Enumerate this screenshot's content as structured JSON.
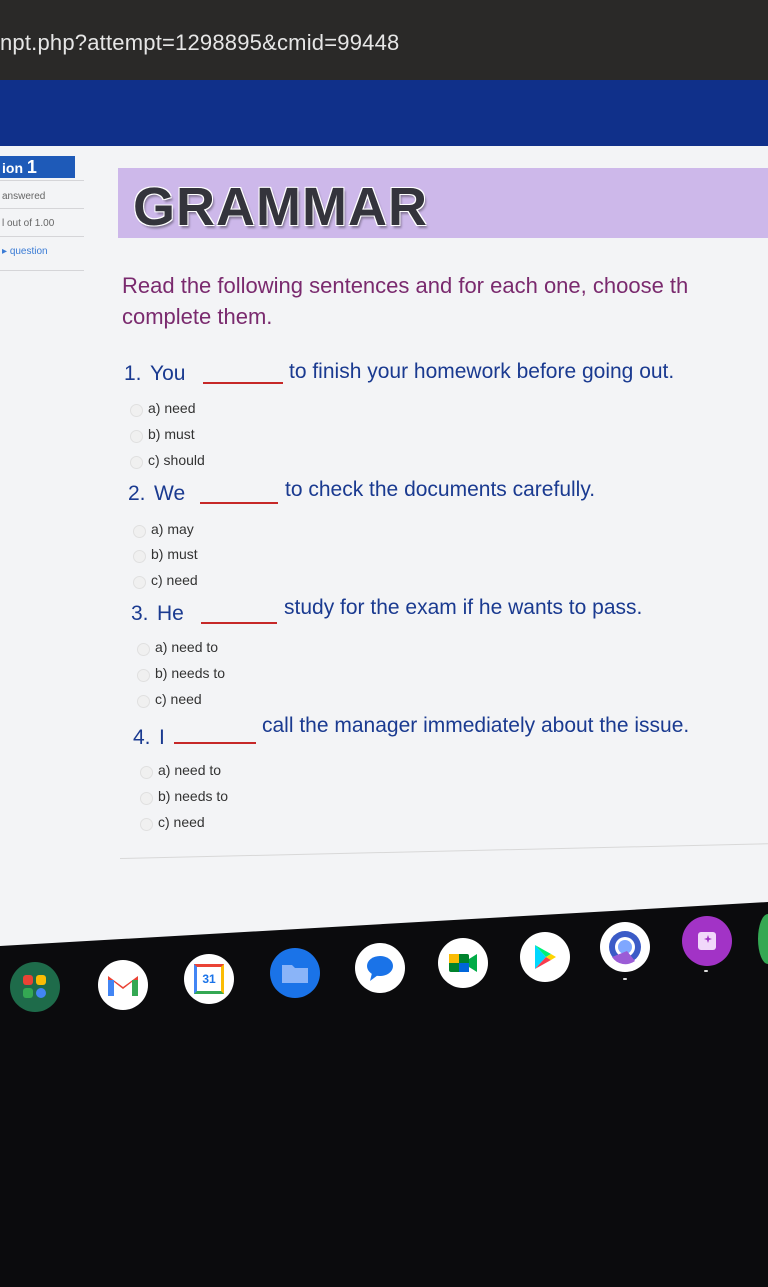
{
  "browser": {
    "url": "npt.php?attempt=1298895&cmid=99448"
  },
  "sidebar": {
    "question_label": "ion ",
    "question_number": "1",
    "status": "answered",
    "marks": "l out of 1.00",
    "flag_label": "question"
  },
  "banner": {
    "title": "GRAMMAR"
  },
  "instructions": {
    "line1": "Read the following sentences and for each one, choose th",
    "line2": "complete them."
  },
  "questions": [
    {
      "number": "1.",
      "subject": "You",
      "rest": "to finish your homework before going out.",
      "options": [
        "a) need",
        "b) must",
        "c) should"
      ]
    },
    {
      "number": "2.",
      "subject": "We",
      "rest": "to check the documents carefully.",
      "options": [
        "a) may",
        "b) must",
        "c) need"
      ]
    },
    {
      "number": "3.",
      "subject": "He",
      "rest": "study for the exam if he wants to pass.",
      "options": [
        "a) need to",
        "b) needs to",
        "c) need"
      ]
    },
    {
      "number": "4.",
      "subject": "I",
      "rest": "call the manager immediately about the issue.",
      "options": [
        "a) need to",
        "b) needs to",
        "c) need"
      ]
    }
  ],
  "shelf": {
    "calendar_day": "31",
    "apps": [
      "launcher-icon",
      "gmail-icon",
      "calendar-icon",
      "files-icon",
      "messages-icon",
      "meet-icon",
      "play-store-icon",
      "chrome-canary-icon",
      "screencast-icon"
    ]
  },
  "colors": {
    "nav": "#10308a",
    "banner": "#cdb8ea",
    "instruction": "#7a2a6e",
    "question": "#1a3a90",
    "blank": "#c62828"
  }
}
